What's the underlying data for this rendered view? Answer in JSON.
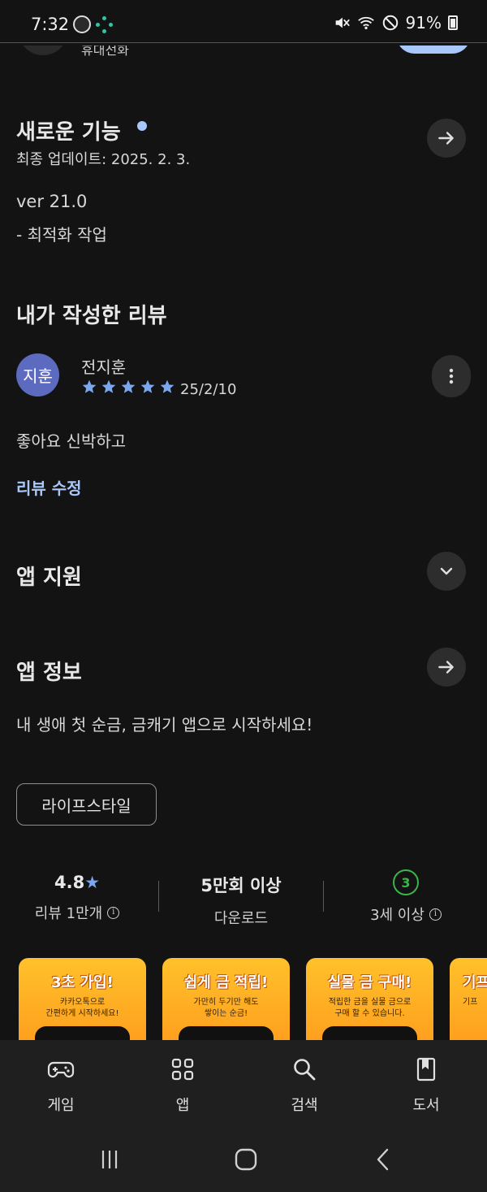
{
  "status_bar": {
    "time": "7:32",
    "battery": "91%"
  },
  "top_clipped": {
    "subtitle": "휴대전화"
  },
  "whats_new": {
    "title": "새로운 기능",
    "updated": "최종 업데이트: 2025. 2. 3.",
    "version": "ver 21.0",
    "note": "- 최적화 작업"
  },
  "my_review": {
    "title": "내가 작성한 리뷰",
    "avatar_text": "지훈",
    "reviewer": "전지훈",
    "rating": 5,
    "date": "25/2/10",
    "body": "좋아요 신박하고",
    "edit_link": "리뷰 수정"
  },
  "app_support": {
    "title": "앱 지원"
  },
  "app_info": {
    "title": "앱 정보",
    "description": "내 생애 첫 순금, 금캐기 앱으로 시작하세요!",
    "category": "라이프스타일"
  },
  "stats": {
    "rating_value": "4.8",
    "rating_star": "★",
    "reviews_label": "리뷰 1만개",
    "downloads_value": "5만회 이상",
    "downloads_label": "다운로드",
    "age_value": "3",
    "age_label": "3세 이상",
    "info_glyph": "i"
  },
  "screenshots": [
    {
      "title": "3초 가입!",
      "subtitle": "카카오톡으로\n간편하게 시작하세요!"
    },
    {
      "title": "쉽게 금 적립!",
      "subtitle": "가만히 두기만 해도\n쌓이는 순금!"
    },
    {
      "title": "실물 금 구매!",
      "subtitle": "적립한 금을 실물 금으로\n구매 할 수 있습니다."
    },
    {
      "title": "기프",
      "subtitle": "기프"
    }
  ],
  "bottom_nav": [
    {
      "label": "게임",
      "icon": "gamepad-icon"
    },
    {
      "label": "앱",
      "icon": "apps-grid-icon"
    },
    {
      "label": "검색",
      "icon": "search-icon"
    },
    {
      "label": "도서",
      "icon": "book-icon"
    }
  ],
  "colors": {
    "background": "#131313",
    "accent": "#a8c7fa",
    "star": "#7aa7ee",
    "age_green": "#3ab54a",
    "screenshot_orange": "#ffb020"
  }
}
